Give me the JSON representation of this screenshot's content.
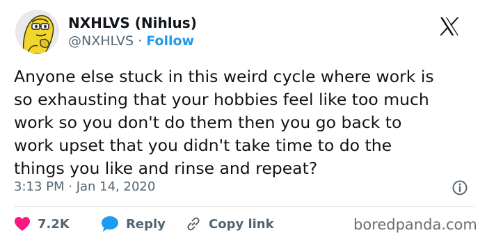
{
  "user": {
    "display_name": "NXHLVS (Nihlus)",
    "handle": "@NXHLVS",
    "separator": "·",
    "follow_label": "Follow",
    "avatar_icon": "yellow-fish-avatar-icon"
  },
  "platform_icon": "x-logo-icon",
  "tweet": {
    "text": "Anyone else stuck in this weird cycle where work is\nso exhausting that your hobbies feel like too much\nwork so you don't do them then you go back to\nwork upset that you didn't take time to do the\nthings you like and rinse and repeat?",
    "timestamp": "3:13 PM · Jan 14, 2020",
    "info_icon": "info-icon"
  },
  "actions": {
    "like_count": "7.2K",
    "reply_label": "Reply",
    "copy_link_label": "Copy link"
  },
  "watermark": "boredpanda.com",
  "colors": {
    "accent_blue": "#1d9bf0",
    "like_pink": "#f91880",
    "muted_text": "#536471",
    "divider": "#cfd9de"
  }
}
